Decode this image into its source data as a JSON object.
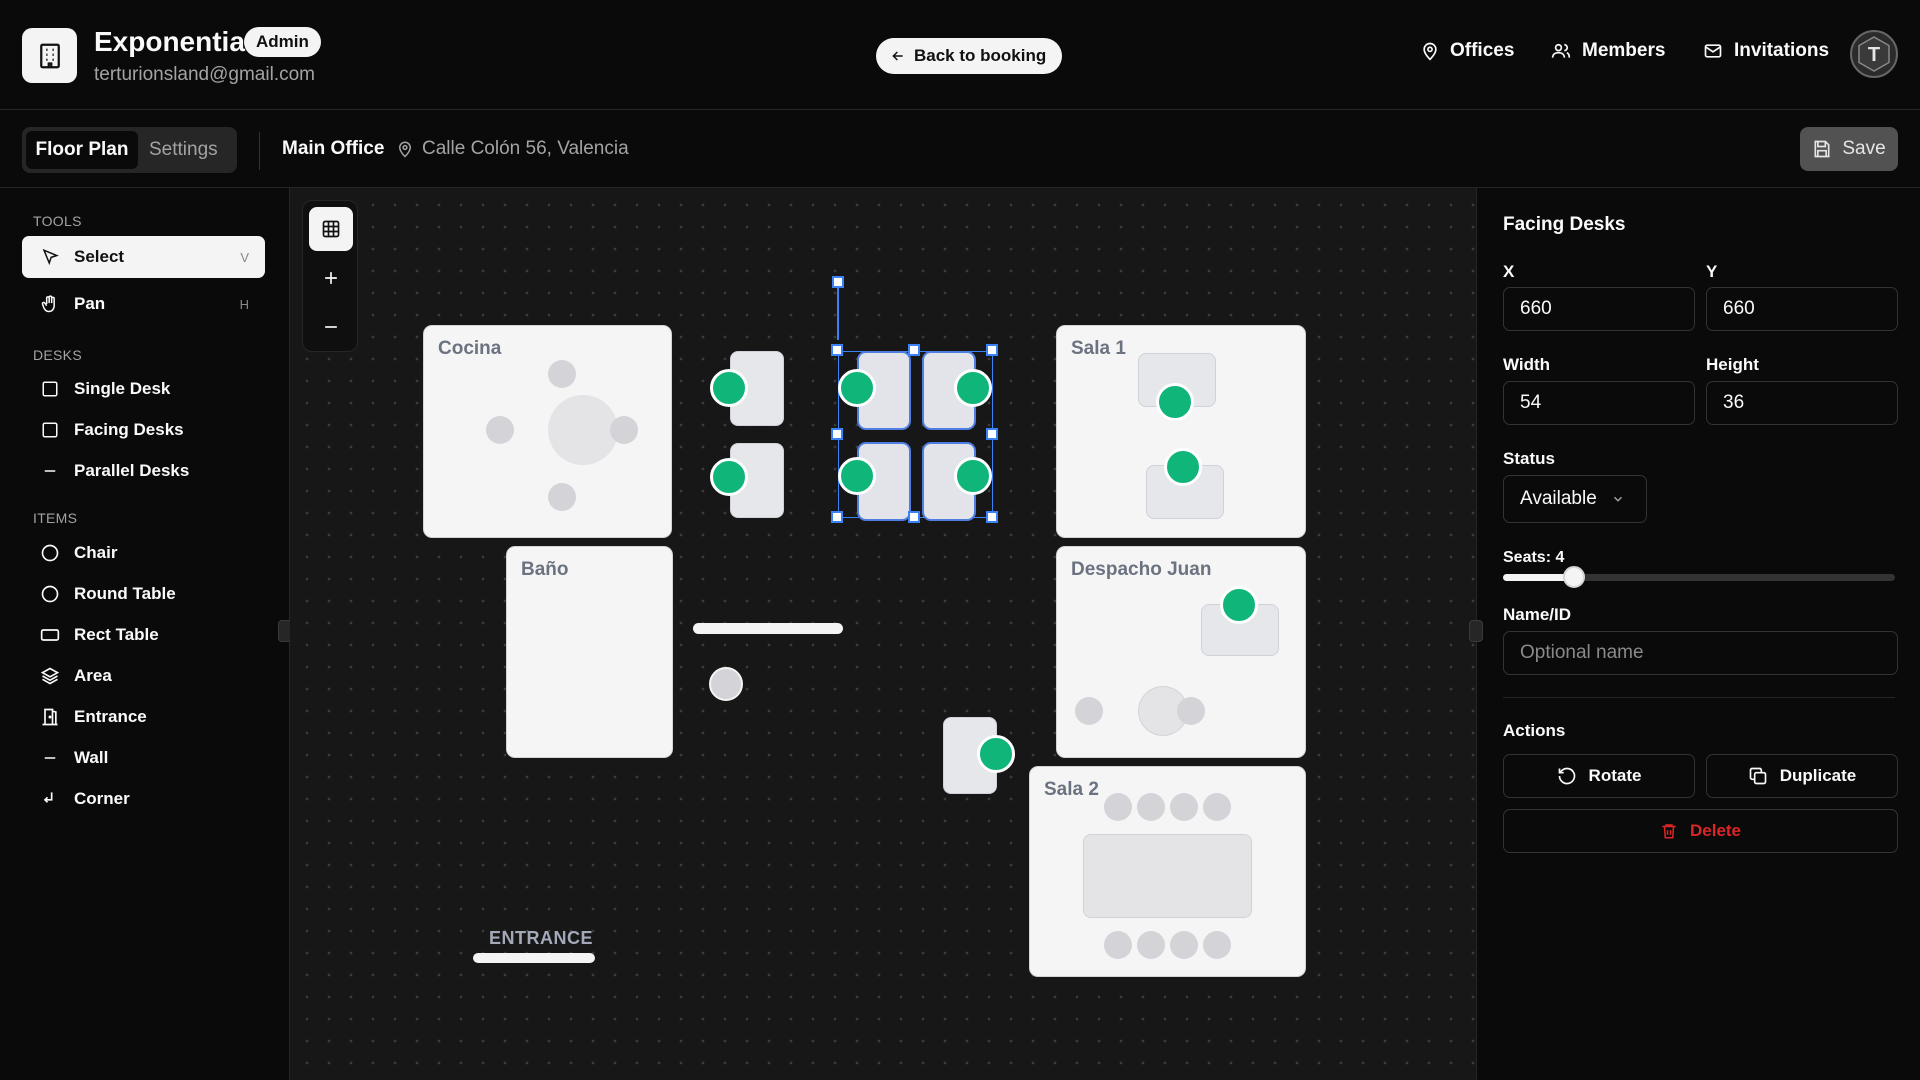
{
  "header": {
    "brand": "Exponentia",
    "role_badge": "Admin",
    "email": "terturionsland@gmail.com",
    "back_button": "Back to booking",
    "nav": [
      {
        "label": "Offices",
        "icon": "map-pin-icon"
      },
      {
        "label": "Members",
        "icon": "users-icon"
      },
      {
        "label": "Invitations",
        "icon": "mail-icon"
      }
    ],
    "avatar_letter": "T"
  },
  "subbar": {
    "tabs": [
      "Floor Plan",
      "Settings"
    ],
    "active_tab": "Floor Plan",
    "office_name": "Main Office",
    "office_address": "Calle Colón 56, Valencia",
    "save_label": "Save"
  },
  "tools": {
    "section_title": "TOOLS",
    "items": [
      {
        "label": "Select",
        "shortcut": "V",
        "icon": "cursor-icon",
        "active": true
      },
      {
        "label": "Pan",
        "shortcut": "H",
        "icon": "hand-icon",
        "active": false
      }
    ]
  },
  "desks": {
    "section_title": "DESKS",
    "items": [
      {
        "label": "Single Desk",
        "icon": "square-icon"
      },
      {
        "label": "Facing Desks",
        "icon": "square-icon"
      },
      {
        "label": "Parallel Desks",
        "icon": "minus-icon"
      }
    ]
  },
  "items": {
    "section_title": "ITEMS",
    "items": [
      {
        "label": "Chair",
        "icon": "circle-icon"
      },
      {
        "label": "Round Table",
        "icon": "circle-icon"
      },
      {
        "label": "Rect Table",
        "icon": "rectangle-icon"
      },
      {
        "label": "Area",
        "icon": "layers-icon"
      },
      {
        "label": "Entrance",
        "icon": "door-icon"
      },
      {
        "label": "Wall",
        "icon": "minus-icon"
      },
      {
        "label": "Corner",
        "icon": "corner-icon"
      }
    ]
  },
  "canvas": {
    "rooms": {
      "cocina": "Cocina",
      "bano": "Baño",
      "sala1": "Sala 1",
      "despacho": "Despacho Juan",
      "sala2": "Sala 2"
    },
    "entrance_label": "ENTRANCE"
  },
  "properties": {
    "title": "Facing Desks",
    "x_label": "X",
    "x_value": "660",
    "y_label": "Y",
    "y_value": "660",
    "width_label": "Width",
    "width_value": "54",
    "height_label": "Height",
    "height_value": "36",
    "status_label": "Status",
    "status_value": "Available",
    "seats_label": "Seats: 4",
    "seats_value": 4,
    "seats_fraction": 0.18,
    "name_label": "Name/ID",
    "name_placeholder": "Optional name",
    "actions_label": "Actions",
    "rotate_label": "Rotate",
    "duplicate_label": "Duplicate",
    "delete_label": "Delete"
  },
  "colors": {
    "seat_available": "#10b57a",
    "selection": "#3b82f6",
    "delete": "#dc2626"
  }
}
